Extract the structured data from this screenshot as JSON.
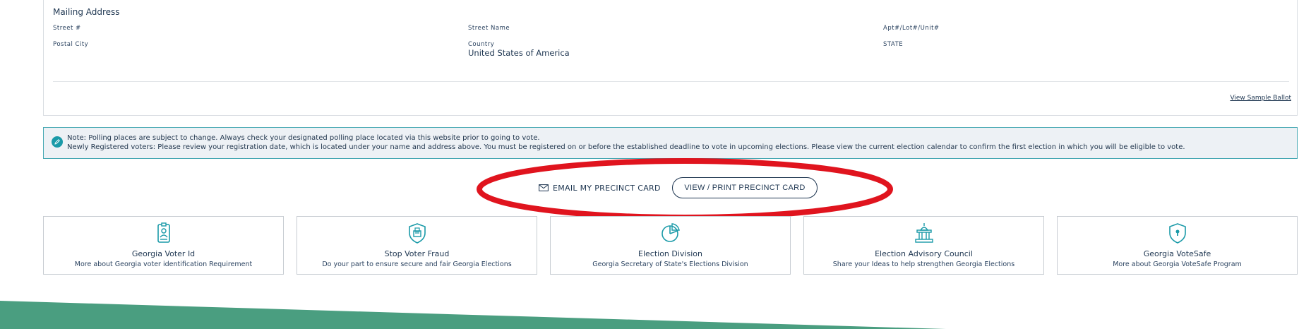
{
  "mailing": {
    "title": "Mailing Address",
    "street_number_label": "Street #",
    "street_name_label": "Street Name",
    "apt_label": "Apt#/Lot#/Unit#",
    "postal_city_label": "Postal City",
    "country_label": "Country",
    "country_value": "United States of America",
    "state_label": "STATE",
    "sample_ballot_link": "View Sample Ballot"
  },
  "note": {
    "line1": "Note: Polling places are subject to change. Always check your designated polling place located via this website prior to going to vote.",
    "line2": "Newly Registered voters: Please review your registration date, which is located under your name and address above. You must be registered on or before the established deadline to vote in upcoming elections. Please view the current election calendar to confirm the first election in which you will be eligible to vote."
  },
  "actions": {
    "email_label": "EMAIL MY PRECINCT CARD",
    "print_label": "VIEW / PRINT PRECINCT CARD"
  },
  "tiles": [
    {
      "title": "Georgia Voter Id",
      "subtitle": "More about Georgia voter identification Requirement",
      "icon": "id-badge-icon"
    },
    {
      "title": "Stop Voter Fraud",
      "subtitle": "Do your part to ensure secure and fair Georgia Elections",
      "icon": "ballot-shield-icon"
    },
    {
      "title": "Election Division",
      "subtitle": "Georgia Secretary of State's Elections Division",
      "icon": "pie-chart-icon"
    },
    {
      "title": "Election Advisory Council",
      "subtitle": "Share your Ideas to help strengthen Georgia Elections",
      "icon": "capitol-building-icon"
    },
    {
      "title": "Georgia VoteSafe",
      "subtitle": "More about Georgia VoteSafe Program",
      "icon": "shield-lock-icon"
    }
  ],
  "colors": {
    "navy": "#1d3550",
    "teal": "#1a9aa8",
    "note_bg": "#edf1f5",
    "annotation_red": "#e0141e",
    "footer_green": "#4a9e80"
  }
}
